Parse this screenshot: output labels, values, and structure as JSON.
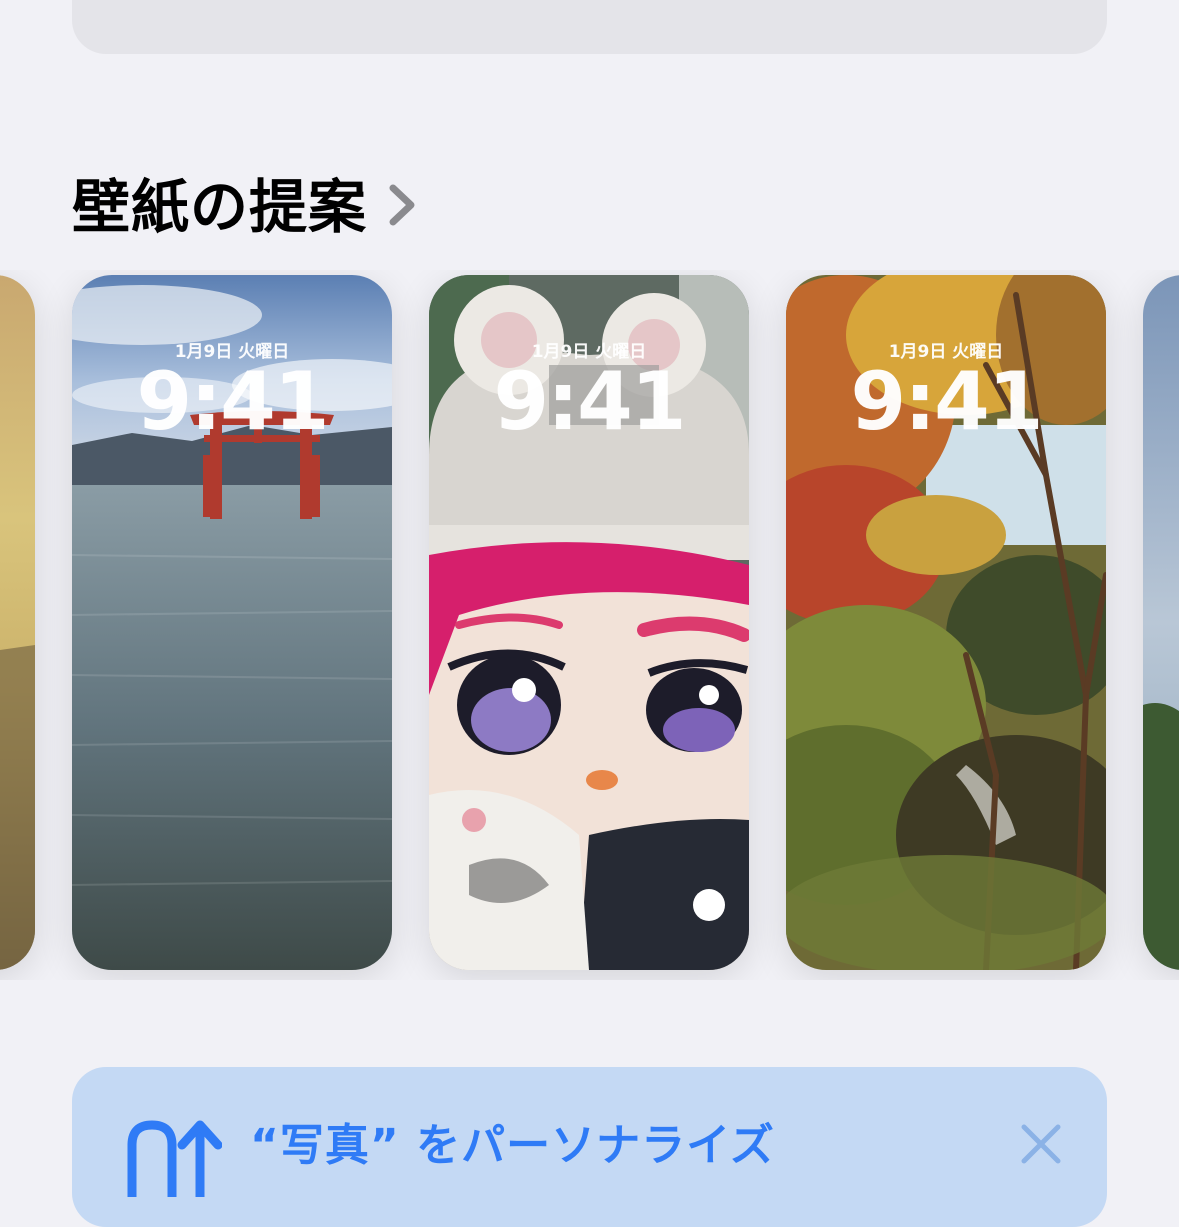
{
  "section": {
    "title": "壁紙の提案",
    "chevron_icon": "chevron-right-icon"
  },
  "wallpapers": [
    {
      "name": "partial-left",
      "date": "",
      "time": ""
    },
    {
      "name": "torii-sea",
      "date": "1月9日 火曜日",
      "time": "9:41"
    },
    {
      "name": "plush-doll",
      "date": "1月9日 火曜日",
      "time": "9:41"
    },
    {
      "name": "autumn-forest",
      "date": "1月9日 火曜日",
      "time": "9:41"
    },
    {
      "name": "partial-right",
      "date": "",
      "time": ""
    }
  ],
  "banner": {
    "text": "“写真” をパーソナライズ",
    "glyph_icon": "personalize-icon",
    "close_icon": "close-icon"
  },
  "colors": {
    "background": "#f1f1f6",
    "accent": "#2f7bf6",
    "banner_bg": "#c4d9f4"
  }
}
